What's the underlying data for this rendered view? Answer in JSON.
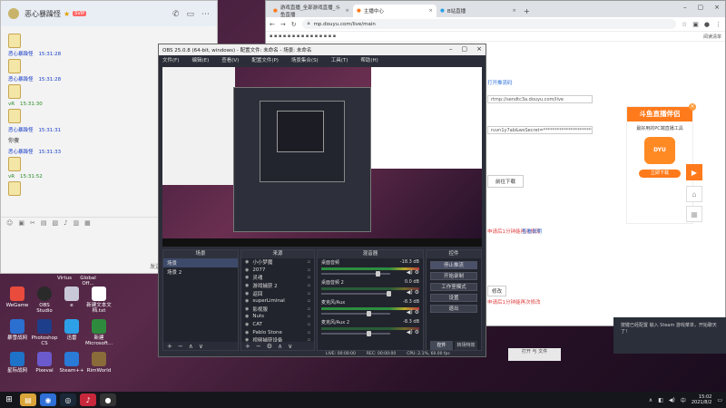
{
  "chat": {
    "title": "恶心暴躁怪",
    "badge": "SVIP",
    "messages": [
      {
        "who": "恶心暴躁怪",
        "time": "15:31:28",
        "color": "blue"
      },
      {
        "who": "恶心暴躁怪",
        "time": "15:31:28",
        "color": "blue"
      },
      {
        "who": "vR",
        "time": "15:31:30",
        "color": "green"
      },
      {
        "who": "恶心暴躁怪",
        "time": "15:31:31",
        "color": "blue",
        "text": "你傻"
      },
      {
        "who": "恶心暴躁怪",
        "time": "15:31:33",
        "color": "blue"
      },
      {
        "who": "vR",
        "time": "15:31:52",
        "color": "green"
      }
    ],
    "send_label": "发送"
  },
  "browser": {
    "tabs": [
      "游戏直播_全部游戏直播_斗鱼直播",
      "主播中心",
      "B站直播"
    ],
    "url": "mp.douyu.com/live/main",
    "bookmarks": [
      "阅读清单"
    ],
    "page": {
      "link1": "打开推流码",
      "rtmp": "rtmp://sendtc3a.douyu.com/live",
      "key": "ruvn1y7ab&wsSecret=****************************&auth=7aiTi",
      "download": "前往下载",
      "note1": "申请后1分钟能再次修改",
      "link2": "查看说明",
      "mod": "修改",
      "note2": "申请后1分钟能再次修改",
      "promo_title": "斗鱼直播伴侣",
      "promo_sub": "最好用的PC端直播工具",
      "promo_logo": "DYU",
      "promo_btn": "立即下载"
    }
  },
  "obs": {
    "title": "OBS 25.0.8 (64-bit, windows) - 配置文件: 未命名 - 场景: 未命名",
    "menu": [
      "文件(F)",
      "编辑(E)",
      "查看(V)",
      "配置文件(P)",
      "场景集合(S)",
      "工具(T)",
      "帮助(H)"
    ],
    "docks": {
      "scenes": "场景",
      "sources": "来源",
      "mixer": "混音器",
      "controls": "控件"
    },
    "scenes": [
      "场景",
      "场景 2"
    ],
    "sources": [
      "小小梦魔",
      "2077",
      "灵魂",
      "游戏捕获 2",
      "返回",
      "superLiminal",
      "影视服",
      "Nuts",
      "CAT",
      "Pablo Stone",
      "视频捕获设备"
    ],
    "mixer": [
      {
        "name": "桌面音频",
        "db": "-18.3 dB"
      },
      {
        "name": "桌面音频 2",
        "db": "0.0 dB"
      },
      {
        "name": "麦克风/Aux",
        "db": "-8.3 dB"
      },
      {
        "name": "麦克风/Aux 2",
        "db": "-8.3 dB"
      }
    ],
    "controls": [
      "停止推流",
      "开始录制",
      "工作室模式",
      "设置",
      "退出"
    ],
    "control_tabs": [
      "控件",
      "转场特效"
    ],
    "status": [
      "LIVE: 00:00:00",
      "REC: 00:00:00",
      "CPU: 2.1%, 60.00 fps"
    ]
  },
  "desktop": {
    "icons": [
      {
        "label": "WeGame",
        "color": "#e94b3c"
      },
      {
        "label": "OBS Studio",
        "color": "#2a2a2a"
      },
      {
        "label": "e",
        "color": "#3a6fd8"
      },
      {
        "label": "新建文本文档.txt",
        "color": "#ffffff"
      },
      {
        "label": "暴雪战网",
        "color": "#2b6fd0"
      },
      {
        "label": "Photoshop CS",
        "color": "#1d3e8a"
      },
      {
        "label": "迅雷",
        "color": "#2da0e8"
      },
      {
        "label": "新建 Microsoft...",
        "color": "#2e8b3e"
      },
      {
        "label": "星际战网",
        "color": "#1e72c8"
      },
      {
        "label": "Pixeval",
        "color": "#6a5acd"
      },
      {
        "label": "Steam++",
        "color": "#2a7ad8"
      },
      {
        "label": "RimWorld",
        "color": "#8a6b3a"
      },
      {
        "label": "Virtus",
        "color": "#444"
      },
      {
        "label": "Global Off...",
        "color": "#555"
      }
    ]
  },
  "toast": {
    "text": "按键已经配置 输入 Steam 游戏菜单，开始聊天了！"
  },
  "toast2": {
    "text": "打开 与 文件"
  },
  "taskbar": {
    "time": "15:02",
    "date": "2021/8/2",
    "apps": [
      "file-explorer",
      "chrome",
      "steam",
      "netease",
      "obs"
    ]
  }
}
